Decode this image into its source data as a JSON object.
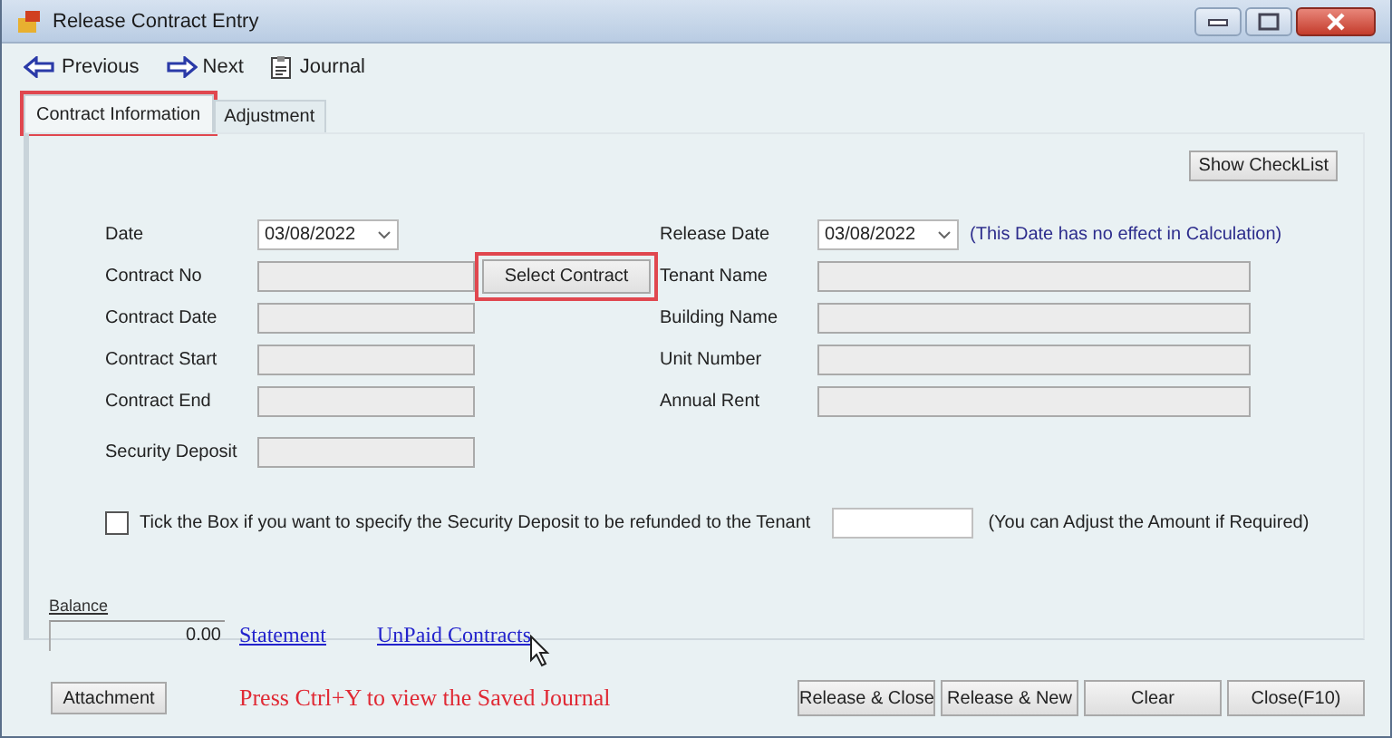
{
  "window": {
    "title": "Release Contract Entry"
  },
  "toolbar": [
    {
      "label": "Previous",
      "kind": "back"
    },
    {
      "label": "Next",
      "kind": "forward"
    },
    {
      "label": "Journal",
      "kind": "journal"
    }
  ],
  "tabs": [
    {
      "label": "Contract Information",
      "selected": true,
      "highlighted": true
    },
    {
      "label": "Adjustment",
      "selected": false,
      "highlighted": false
    }
  ],
  "show_checklist_button": "Show CheckList",
  "left_fields": [
    {
      "label": "Date",
      "kind": "date",
      "value": "03/08/2022"
    },
    {
      "label": "Contract No",
      "kind": "text"
    },
    {
      "label": "Contract Date",
      "kind": "text"
    },
    {
      "label": "Contract Start",
      "kind": "text"
    },
    {
      "label": "Contract End",
      "kind": "text"
    },
    {
      "label": "Security Deposit",
      "kind": "text"
    }
  ],
  "select_contract_button": {
    "label": "Select Contract",
    "highlighted": true
  },
  "right_fields": [
    {
      "label": "Release Date",
      "kind": "date",
      "value": "03/08/2022",
      "note": "(This Date has no effect in Calculation)"
    },
    {
      "label": "Tenant Name",
      "kind": "text"
    },
    {
      "label": "Building Name",
      "kind": "text"
    },
    {
      "label": "Unit Number",
      "kind": "text"
    },
    {
      "label": "Annual Rent",
      "kind": "text"
    }
  ],
  "refund": {
    "label": "Tick the Box if you want to specify the Security Deposit to  be refunded to the Tenant",
    "checked": false,
    "note": "(You can Adjust the Amount if Required)"
  },
  "balance": {
    "label": "Balance",
    "value": "0.00"
  },
  "links": [
    "Statement",
    "UnPaid Contracts"
  ],
  "attachment_button": "Attachment",
  "hint": "Press Ctrl+Y to view the Saved  Journal",
  "action_buttons": [
    "Release & Close",
    "Release & New",
    "Clear",
    "Close(F10)"
  ]
}
